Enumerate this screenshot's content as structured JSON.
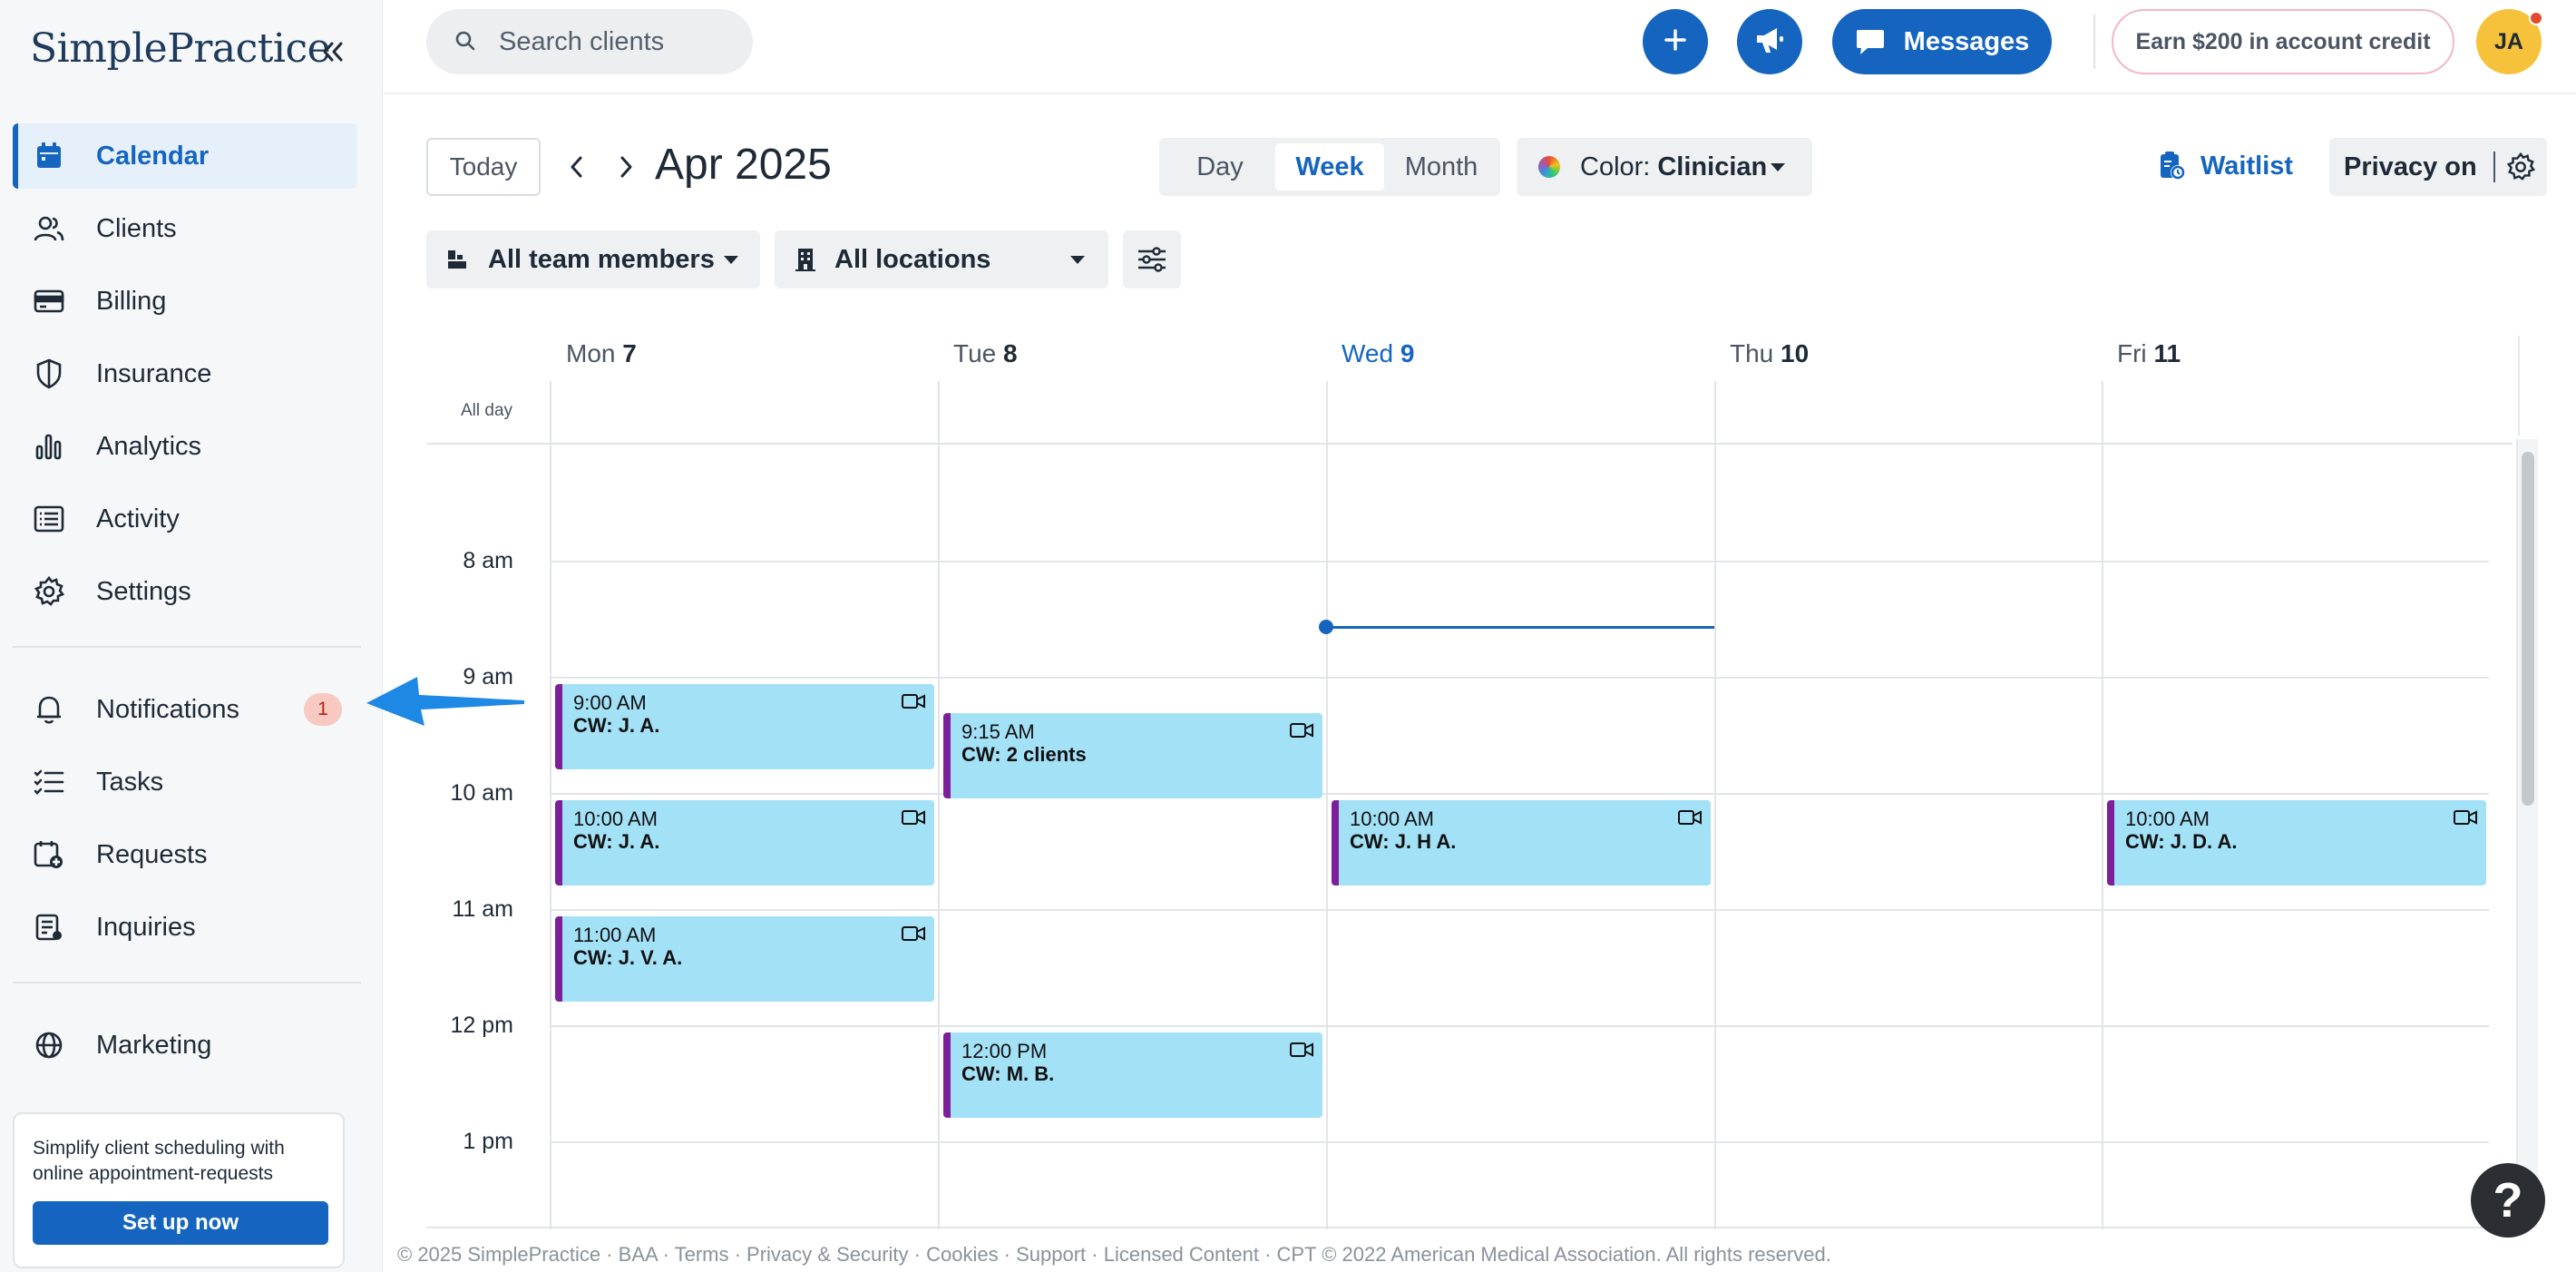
{
  "app": {
    "logo_text": "SimplePractice"
  },
  "sidebar": {
    "items": [
      {
        "label": "Calendar",
        "icon": "calendar-icon",
        "active": true
      },
      {
        "label": "Clients",
        "icon": "clients-icon"
      },
      {
        "label": "Billing",
        "icon": "credit-card-icon"
      },
      {
        "label": "Insurance",
        "icon": "shield-icon"
      },
      {
        "label": "Analytics",
        "icon": "bar-chart-icon"
      },
      {
        "label": "Activity",
        "icon": "activity-list-icon"
      },
      {
        "label": "Settings",
        "icon": "gear-icon"
      },
      {
        "label": "Notifications",
        "icon": "bell-icon",
        "badge": "1"
      },
      {
        "label": "Tasks",
        "icon": "checklist-icon"
      },
      {
        "label": "Requests",
        "icon": "calendar-plus-icon"
      },
      {
        "label": "Inquiries",
        "icon": "inquiries-icon"
      },
      {
        "label": "Marketing",
        "icon": "globe-icon"
      }
    ],
    "promo": {
      "text": "Simplify client scheduling with online appointment-requests",
      "button": "Set up now"
    }
  },
  "topbar": {
    "search_placeholder": "Search clients",
    "messages_label": "Messages",
    "earn_label": "Earn $200 in account credit",
    "avatar_initials": "JA"
  },
  "toolbar": {
    "today_label": "Today",
    "month_title": "Apr 2025",
    "views": [
      "Day",
      "Week",
      "Month"
    ],
    "selected_view": "Week",
    "color_prefix": "Color:",
    "color_value": "Clinician",
    "waitlist_label": "Waitlist",
    "privacy_label": "Privacy on",
    "team_filter": "All team members",
    "location_filter": "All locations"
  },
  "calendar": {
    "days": [
      {
        "name": "Mon",
        "num": "7"
      },
      {
        "name": "Tue",
        "num": "8"
      },
      {
        "name": "Wed",
        "num": "9",
        "today": true
      },
      {
        "name": "Thu",
        "num": "10"
      },
      {
        "name": "Fri",
        "num": "11"
      }
    ],
    "allday_label": "All day",
    "times": [
      "8 am",
      "9 am",
      "10 am",
      "11 am",
      "12 pm",
      "1 pm"
    ],
    "appointments": [
      {
        "day": "Mon",
        "time": "9:00 AM",
        "title": "CW: J. A.",
        "video": true
      },
      {
        "day": "Mon",
        "time": "10:00 AM",
        "title": "CW: J. A.",
        "video": true
      },
      {
        "day": "Mon",
        "time": "11:00 AM",
        "title": "CW: J. V. A.",
        "video": true
      },
      {
        "day": "Tue",
        "time": "9:15 AM",
        "title": "CW: 2 clients",
        "video": true
      },
      {
        "day": "Tue",
        "time": "12:00 PM",
        "title": "CW: M. B.",
        "video": true
      },
      {
        "day": "Wed",
        "time": "10:00 AM",
        "title": "CW: J. H A.",
        "video": true
      },
      {
        "day": "Fri",
        "time": "10:00 AM",
        "title": "CW: J. D. A.",
        "video": true
      }
    ]
  },
  "footer": {
    "text": "© 2025 SimplePractice · BAA · Terms · Privacy & Security · Cookies · Support · Licensed Content · CPT © 2022 American Medical Association. All rights reserved."
  },
  "help_label": "?",
  "colors": {
    "brand_blue": "#1565c0",
    "appointment_fill": "#a3e1f7",
    "appointment_accent": "#7d1f9b",
    "avatar": "#f7c23b"
  }
}
